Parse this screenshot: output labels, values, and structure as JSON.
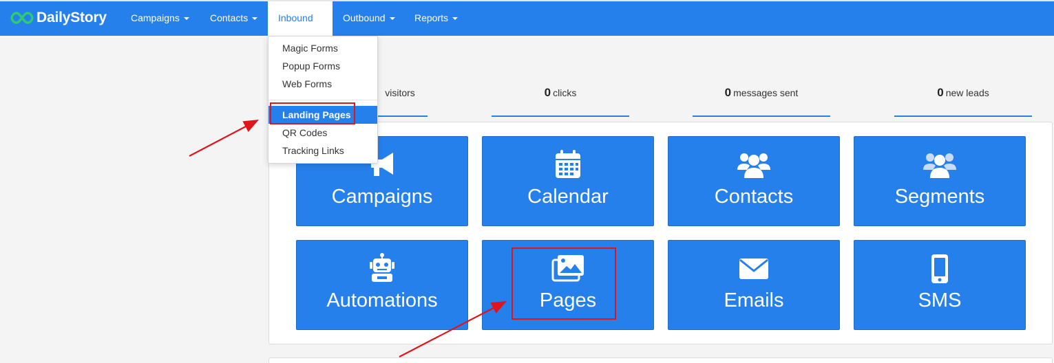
{
  "brand": {
    "name": "DailyStory"
  },
  "nav": {
    "campaigns": "Campaigns",
    "contacts": "Contacts",
    "inbound": "Inbound",
    "outbound": "Outbound",
    "reports": "Reports"
  },
  "dropdown": {
    "items": [
      "Magic Forms",
      "Popup Forms",
      "Web Forms",
      "Landing Pages",
      "QR Codes",
      "Tracking Links"
    ],
    "selected": "Landing Pages"
  },
  "stats": [
    {
      "label": "visitors"
    },
    {
      "value": "0",
      "label": "clicks"
    },
    {
      "value": "0",
      "label": "messages sent"
    },
    {
      "value": "0",
      "label": "new leads"
    }
  ],
  "tiles": [
    {
      "label": "Campaigns",
      "icon": "megaphone-icon"
    },
    {
      "label": "Calendar",
      "icon": "calendar-icon"
    },
    {
      "label": "Contacts",
      "icon": "users-icon"
    },
    {
      "label": "Segments",
      "icon": "user-group-icon"
    },
    {
      "label": "Automations",
      "icon": "robot-icon"
    },
    {
      "label": "Pages",
      "icon": "images-icon"
    },
    {
      "label": "Emails",
      "icon": "envelope-icon"
    },
    {
      "label": "SMS",
      "icon": "mobile-phone-icon"
    }
  ],
  "colors": {
    "brand_blue": "#2680eb",
    "brand_green": "#2ecc71",
    "annotation_red": "#e0141b"
  }
}
